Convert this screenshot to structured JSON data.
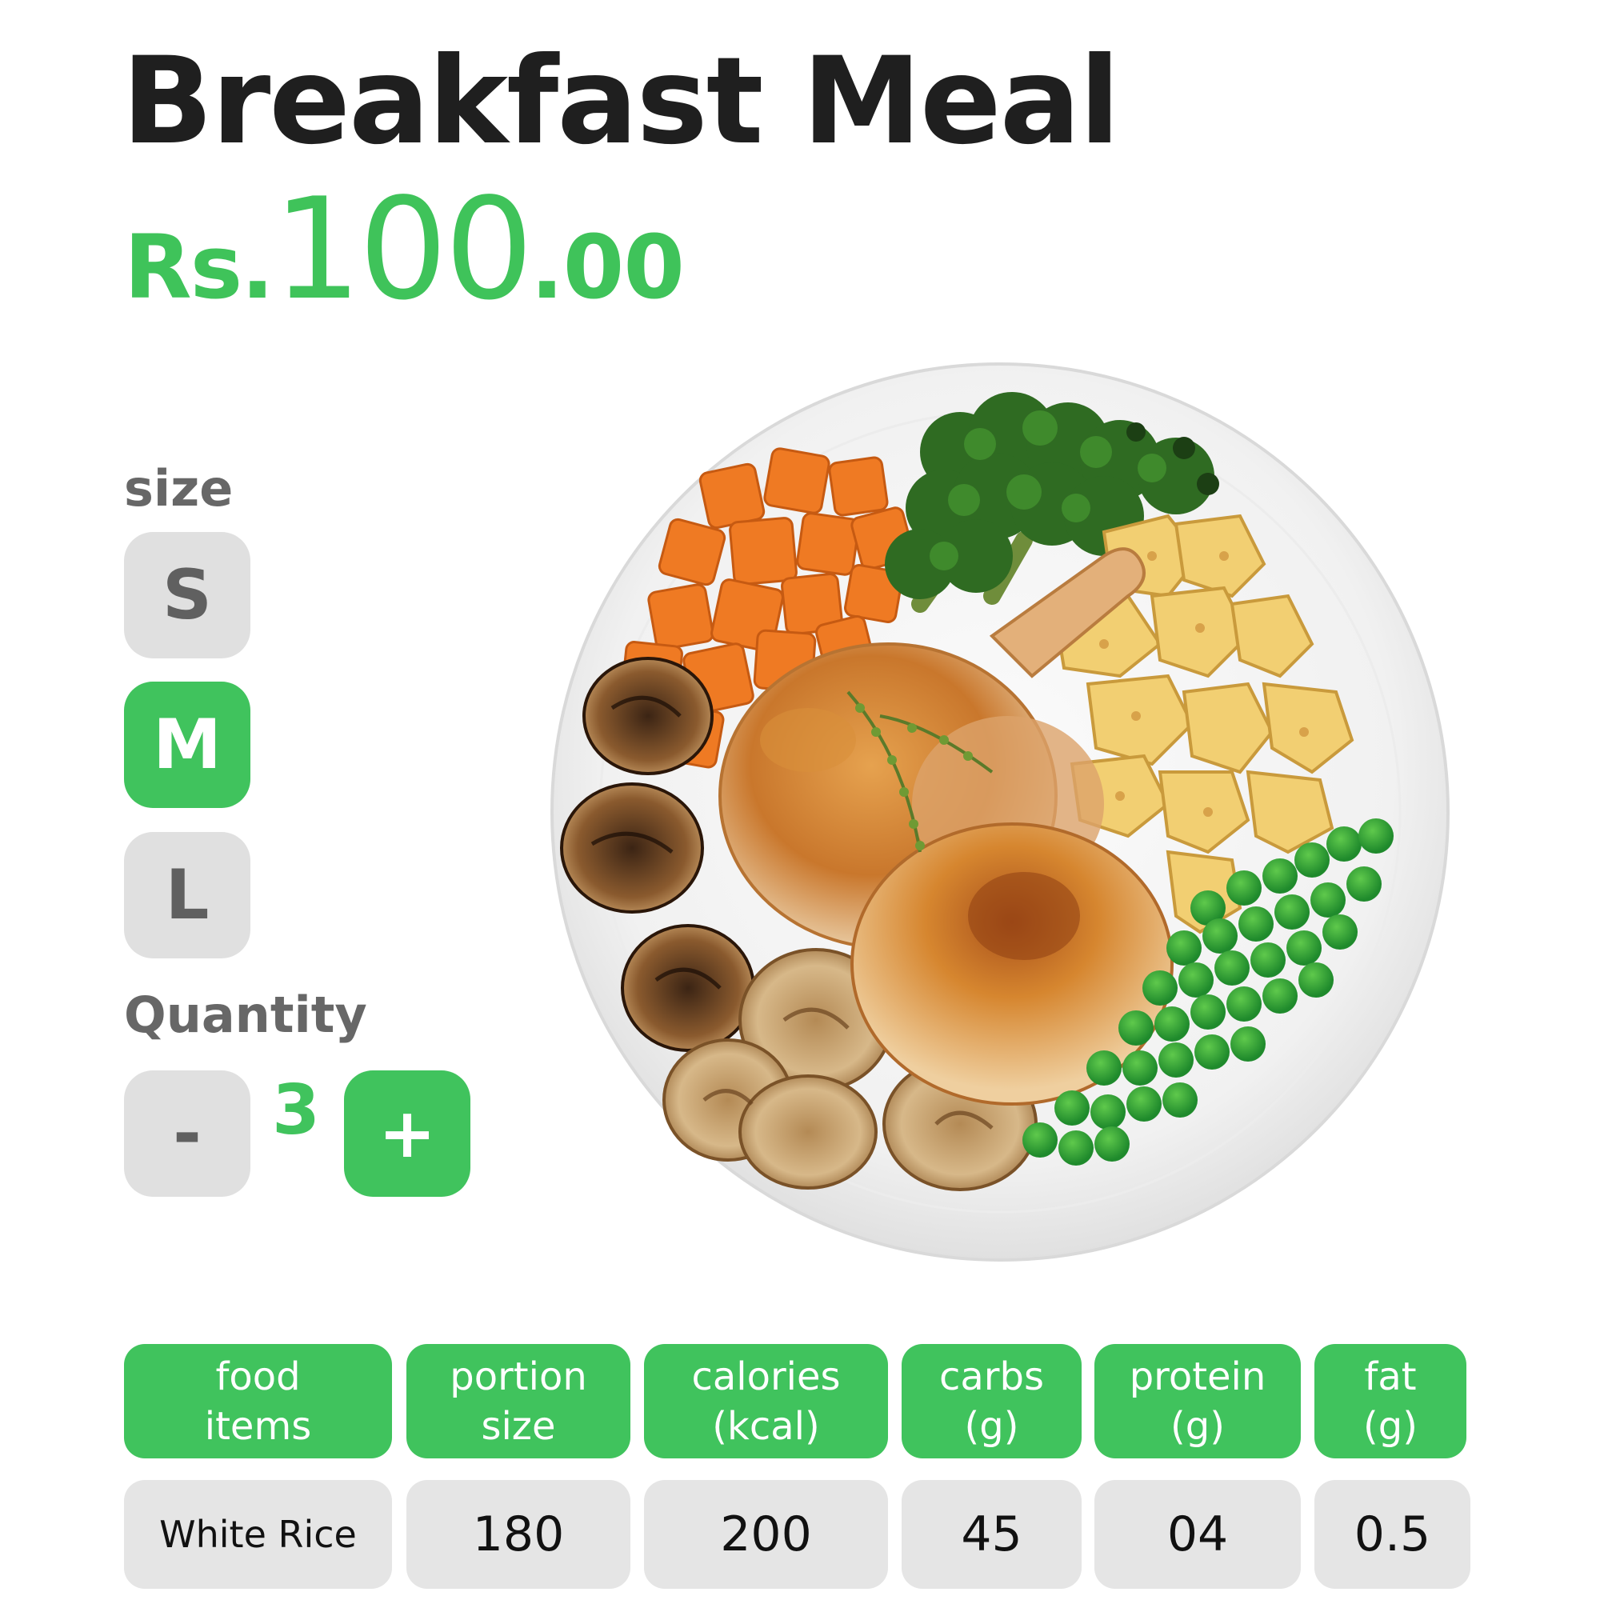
{
  "product": {
    "title": "Breakfast Meal",
    "price_currency": "Rs.",
    "price_main": "100",
    "price_decimal": ".00"
  },
  "size": {
    "label": "size",
    "options": [
      "S",
      "M",
      "L"
    ],
    "selected": "M"
  },
  "quantity": {
    "label": "Quantity",
    "decrement_label": "-",
    "value": "3",
    "increment_label": "+"
  },
  "nutrition": {
    "headers": [
      "food\nitems",
      "portion\nsize",
      "calories\n(kcal)",
      "carbs\n(g)",
      "protein\n(g)",
      "fat\n(g)"
    ],
    "rows": [
      [
        "White Rice",
        "180",
        "200",
        "45",
        "04",
        "0.5"
      ]
    ]
  },
  "colors": {
    "accent_green": "#40c35d",
    "button_grey": "#e0e0e0",
    "title_text": "#1f1f1f"
  },
  "icons": {
    "meal_image": "roast-chicken-plate-image"
  }
}
